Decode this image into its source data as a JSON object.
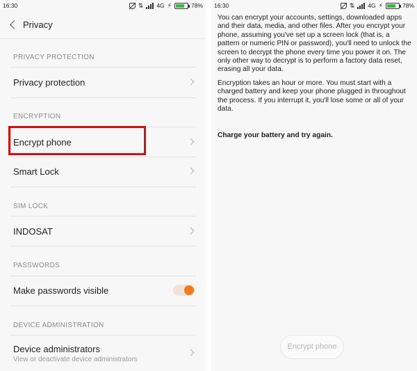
{
  "status_bar": {
    "time": "16:30",
    "network": "4G",
    "battery_percent": "78%",
    "battery_level": 0.78,
    "battery_color": "#3bb54a"
  },
  "left_screen": {
    "title": "Privacy",
    "sections": [
      {
        "header": "PRIVACY PROTECTION",
        "items": [
          {
            "label": "Privacy protection"
          }
        ]
      },
      {
        "header": "ENCRYPTION",
        "items": [
          {
            "label": "Encrypt phone"
          },
          {
            "label": "Smart Lock"
          }
        ]
      },
      {
        "header": "SIM LOCK",
        "items": [
          {
            "label": "INDOSAT"
          }
        ]
      },
      {
        "header": "PASSWORDS",
        "items": [
          {
            "label": "Make passwords visible",
            "toggle_on": true
          }
        ]
      },
      {
        "header": "DEVICE ADMINISTRATION",
        "items": [
          {
            "label": "Device administrators",
            "sublabel": "View or deactivate device administrators"
          }
        ]
      }
    ],
    "highlight_color": "#d40f0f",
    "toggle_color": "#f07b1e"
  },
  "right_screen": {
    "paragraph_1": "You can encrypt your accounts, settings, downloaded apps and their data, media, and other files. After you encrypt your phone, assuming you've set up a screen lock (that is, a pattern or numeric PIN or password), you'll need to unlock the screen to decrypt the phone every time you power it on. The only other way to decrypt is to perform a factory data reset, erasing all your data.",
    "paragraph_2": "Encryption takes an hour or more. You must start with a charged battery and keep your phone plugged in throughout the process. If you interrupt it, you'll lose some or all of your data.",
    "warning": "Charge your battery and try again.",
    "button_label": "Encrypt phone"
  }
}
